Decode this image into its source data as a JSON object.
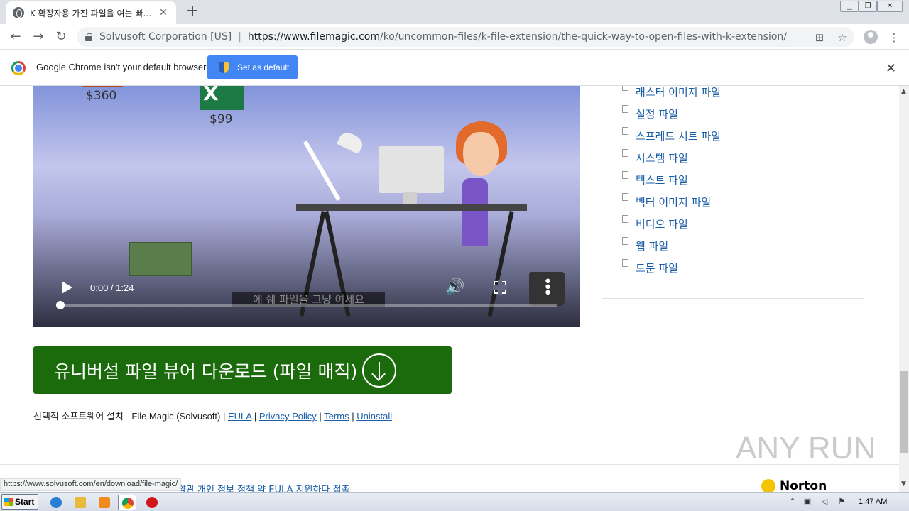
{
  "browser": {
    "tab_title": "K 확장자용 가진 파일을 여는 빠른 방",
    "tab_close": "✕",
    "new_tab": "+",
    "url_owner": "Solvusoft Corporation [US]",
    "url_scheme_host": "https://www.filemagic.com",
    "url_path": "/ko/uncommon-files/k-file-extension/the-quick-way-to-open-files-with-k-extension/",
    "back_icon": "arrow-left-icon",
    "forward_icon": "arrow-right-icon",
    "reload_icon": "reload-icon"
  },
  "infobar": {
    "message": "Google Chrome isn't your default browser",
    "set_default_label": "Set as default",
    "close": "✕"
  },
  "video": {
    "time": "0:00 / 1:24",
    "caption": "에 쉐 파일을 그냥 여세요",
    "price_a": "$360",
    "price_b": "$99",
    "excel_letter": "X",
    "progress": 0.0
  },
  "download_button": {
    "label": "유니버설 파일 뷰어 다운로드 (파일 매직)"
  },
  "legal": {
    "prefix": "선택적 소프트웨어 설치 - File Magic (Solvusoft) |",
    "eula": "EULA",
    "privacy": "Privacy Policy",
    "terms": "Terms",
    "uninstall": "Uninstall",
    "sep": "|"
  },
  "sidebar": {
    "items": [
      "래스터 이미지 파일",
      "설정 파일",
      "스프레드 시트 파일",
      "시스템 파일",
      "텍스트 파일",
      "벡터 이미지 파일",
      "비디오 파일",
      "웹 파일",
      "드문 파일"
    ]
  },
  "footer": {
    "links_text": "약관   개인 정보 정책   약   EULA   지원하다   접촉",
    "norton": "Norton"
  },
  "watermark": "ANY RUN",
  "status_url": "https://www.solvusoft.com/en/download/file-magic/",
  "taskbar": {
    "start": "Start",
    "clock": "1:47 AM"
  }
}
